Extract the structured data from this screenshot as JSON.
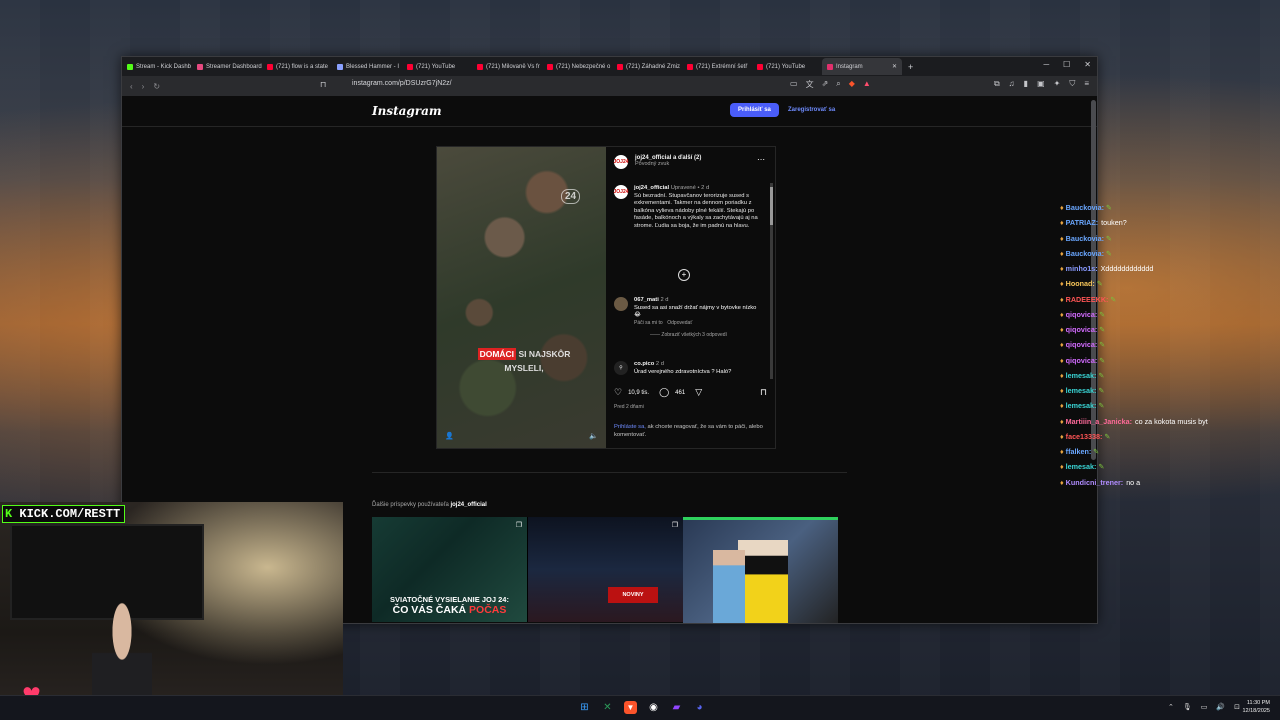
{
  "browser": {
    "tabs": [
      {
        "label": "Stream - Kick Dashb",
        "color": "#53fc18"
      },
      {
        "label": "Streamer Dashboard",
        "color": "#e64980"
      },
      {
        "label": "(721) flow is a state",
        "color": "#ff0033"
      },
      {
        "label": "Blessed Hammer - I",
        "color": "#8aa0ff"
      },
      {
        "label": "(721) YouTube",
        "color": "#ff0033"
      },
      {
        "label": "(721) Milovaně Vs fr",
        "color": "#ff0033"
      },
      {
        "label": "(721) Nebezpečné o",
        "color": "#ff0033"
      },
      {
        "label": "(721) Záhadné Zmiz",
        "color": "#ff0033"
      },
      {
        "label": "(721) Extrémní šetř",
        "color": "#ff0033"
      },
      {
        "label": "(721) YouTube",
        "color": "#ff0033"
      },
      {
        "label": "Instagram",
        "color": "#e1306c",
        "active": true
      }
    ],
    "url": "instagram.com/p/DSUzrG7jN2z/"
  },
  "instagram": {
    "logo": "Instagram",
    "login": "Prihlásiť sa",
    "register": "Zaregistrovať sa",
    "post": {
      "author_line": "joj24_official a ďalší (2)",
      "audio": "Pôvodný zvuk",
      "video_overlay_highlight": "DOMÁCI",
      "video_overlay_text": "SI NAJSKÔR MYSLELI,",
      "video_logo": "24",
      "avatar_text": "JOJ24",
      "caption_author": "joj24_official",
      "caption_meta": "Upravené • 2 d",
      "caption_text": "Sú bezradní. Stupavčanov terorizuje sused s exkrementami. Takmer na dennom poriadku z balkóna vylieva nádoby plné fekálií. Stekajú po fasáde, balkónoch a výkaly sa zachytávajú aj na strome. Ľudia sa boja, že im padnú na hlavu.",
      "comments": [
        {
          "user": "067_mati",
          "time": "2 d",
          "text": "Sused sa asi snaží držať nájmy v bytovke nízko 😂",
          "likes": "Páči sa mi to",
          "reply": "Odpovedať",
          "view_replies": "Zobraziť všetkých 3 odpovedí"
        },
        {
          "user": "co.pico",
          "time": "2 d",
          "text": "Úrad verejného zdravotníctva ? Haló?"
        }
      ],
      "like_count": "10,9 tis.",
      "comment_count": "461",
      "ago": "Pred 2 dňami",
      "hint_link": "Prihláste sa,",
      "hint_text": "ak chcete reagovať, že sa vám to páči, alebo komentovať."
    },
    "more_posts_prefix": "Ďalšie príspevky používateľa",
    "more_posts_user": "joj24_official",
    "thumbs": [
      {
        "line1": "SVIATOČNÉ VYSIELANIE JOJ 24:",
        "line2": "ČO VÁS ČAKÁ",
        "line3": "POČAS"
      },
      {
        "sign": "NOVINY"
      },
      {}
    ]
  },
  "overlay": {
    "kick_prefix": "K",
    "kick_text": "KICK.COM/RESTT"
  },
  "chat": [
    {
      "user": "Bauckovia:",
      "user_color": "#6aa7ff",
      "msg": "",
      "emote": true
    },
    {
      "user": "PATRIAZ:",
      "user_color": "#6aa7ff",
      "msg": "touken?",
      "emote": false
    },
    {
      "user": "Bauckovia:",
      "user_color": "#6aa7ff",
      "msg": "",
      "emote": true
    },
    {
      "user": "Bauckovia:",
      "user_color": "#6aa7ff",
      "msg": "",
      "emote": true
    },
    {
      "user": "minho1s:",
      "user_color": "#8a9bff",
      "msg": "Xdddddddddddd",
      "emote": false
    },
    {
      "user": "Hoonad:",
      "user_color": "#f7c65a",
      "msg": "",
      "emote": true
    },
    {
      "user": "RADEEEKK:",
      "user_color": "#ff5555",
      "msg": "",
      "emote": true
    },
    {
      "user": "qiqovica:",
      "user_color": "#d36bff",
      "msg": "",
      "emote": true
    },
    {
      "user": "qiqovica:",
      "user_color": "#d36bff",
      "msg": "",
      "emote": true
    },
    {
      "user": "qiqovica:",
      "user_color": "#d36bff",
      "msg": "",
      "emote": true
    },
    {
      "user": "qiqovica:",
      "user_color": "#d36bff",
      "msg": "",
      "emote": true
    },
    {
      "user": "lemesak:",
      "user_color": "#3ad4d4",
      "msg": "",
      "emote": true
    },
    {
      "user": "lemesak:",
      "user_color": "#3ad4d4",
      "msg": "",
      "emote": true
    },
    {
      "user": "lemesak:",
      "user_color": "#3ad4d4",
      "msg": "",
      "emote": true
    },
    {
      "user": "Martiiin_a_Janicka:",
      "user_color": "#ff6a9a",
      "msg": "co za kokota musis byt",
      "emote": false
    },
    {
      "user": "face13338:",
      "user_color": "#ff5555",
      "msg": "",
      "emote": true
    },
    {
      "user": "ffalken:",
      "user_color": "#6aa7ff",
      "msg": "",
      "emote": true
    },
    {
      "user": "lemesak:",
      "user_color": "#3ad4d4",
      "msg": "",
      "emote": true
    },
    {
      "user": "Kundicni_trener:",
      "user_color": "#b08cff",
      "msg": "no a",
      "emote": false
    }
  ],
  "taskbar": {
    "time": "11:30 PM",
    "date": "12/18/2025"
  },
  "colors": {
    "accent": "#4a5df9",
    "kick": "#53fc18"
  }
}
